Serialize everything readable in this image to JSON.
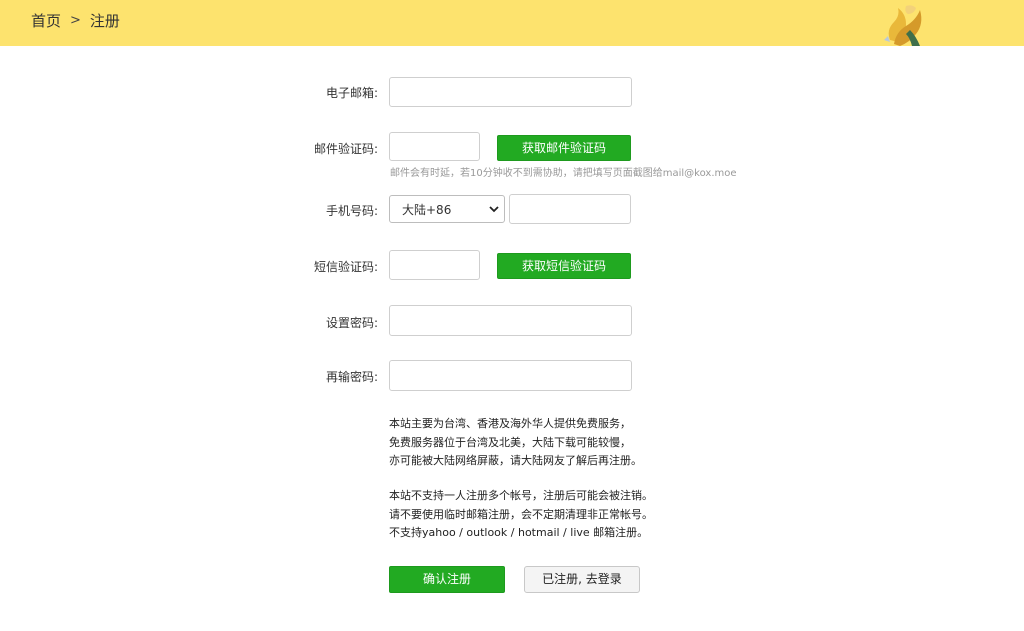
{
  "breadcrumb": {
    "home": "首页",
    "separator": ">",
    "current": "注册"
  },
  "form": {
    "email_label": "电子邮箱:",
    "email_value": "",
    "email_code_label": "邮件验证码:",
    "email_code_value": "",
    "get_email_code_button": "获取邮件验证码",
    "email_hint": "邮件会有时延，若10分钟收不到需协助，请把填写页面截图给mail@kox.moe",
    "phone_label": "手机号码:",
    "country_select_value": "大陆+86",
    "phone_value": "",
    "sms_code_label": "短信验证码:",
    "sms_code_value": "",
    "get_sms_code_button": "获取短信验证码",
    "password_label": "设置密码:",
    "password_value": "",
    "password_confirm_label": "再输密码:",
    "password_confirm_value": ""
  },
  "notice": {
    "paragraph1": [
      "本站主要为台湾、香港及海外华人提供免费服务，",
      "免费服务器位于台湾及北美，大陆下载可能较慢，",
      "亦可能被大陆网络屏蔽，请大陆网友了解后再注册。"
    ],
    "paragraph2": [
      "本站不支持一人注册多个帐号，注册后可能会被注销。",
      "请不要使用临时邮箱注册，会不定期清理非正常帐号。",
      "不支持yahoo / outlook / hotmail / live 邮箱注册。"
    ]
  },
  "actions": {
    "confirm_button": "确认注册",
    "login_button": "已注册, 去登录"
  },
  "colors": {
    "topbar": "#fde36e",
    "primary_green": "#22aa22"
  },
  "icons": {
    "country_select": "chevron-down-icon",
    "mascot": "mascot-character-icon"
  }
}
